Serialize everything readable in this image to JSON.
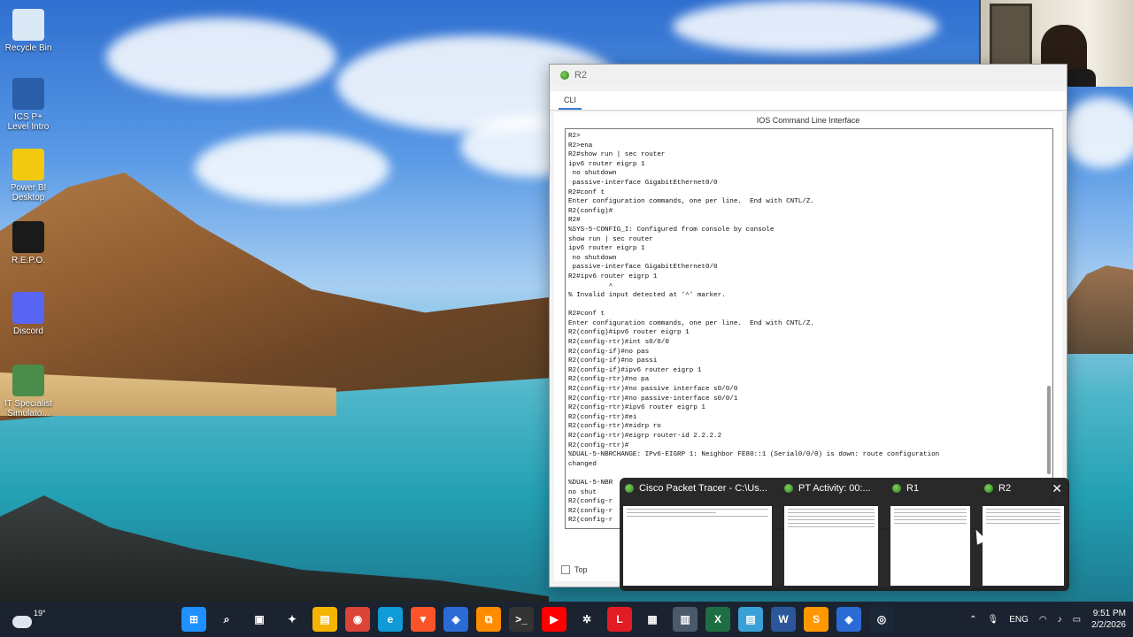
{
  "desktop_icons": [
    {
      "label": "Recycle Bin",
      "icon": "recycle-bin-icon",
      "color": "#dbe8f5"
    },
    {
      "label": "ICS P+ Level Intro",
      "icon": "plus-icon",
      "color": "#2a5ea8"
    },
    {
      "label": "Power BI Desktop",
      "icon": "power-bi-icon",
      "color": "#f2c811"
    },
    {
      "label": "R.E.P.O.",
      "icon": "repo-icon",
      "color": "#1a1a1a"
    },
    {
      "label": "Discord",
      "icon": "discord-icon",
      "color": "#5865f2"
    },
    {
      "label": "IT Specialist Simulato...",
      "icon": "network-icon",
      "color": "#4a8c4a"
    }
  ],
  "window": {
    "title": "R2",
    "tab": "CLI",
    "panel_title": "IOS Command Line Interface",
    "top_checkbox_label": "Top",
    "cli_lines": [
      "R2>",
      "R2>ena",
      "R2#show run | sec router",
      "ipv6 router eigrp 1",
      " no shutdown",
      " passive-interface GigabitEthernet0/0",
      "R2#conf t",
      "Enter configuration commands, one per line.  End with CNTL/Z.",
      "R2(config)#",
      "R2#",
      "%SYS-5-CONFIG_I: Configured from console by console",
      "show run | sec router",
      "ipv6 router eigrp 1",
      " no shutdown",
      " passive-interface GigabitEthernet0/0",
      "R2#ipv6 router eigrp 1",
      "          ^",
      "% Invalid input detected at '^' marker.",
      "",
      "R2#conf t",
      "Enter configuration commands, one per line.  End with CNTL/Z.",
      "R2(config)#ipv6 router eigrp 1",
      "R2(config-rtr)#int s0/0/0",
      "R2(config-if)#no pas",
      "R2(config-if)#no passi",
      "R2(config-if)#ipv6 router eigrp 1",
      "R2(config-rtr)#no pa",
      "R2(config-rtr)#no passive interface s0/0/0",
      "R2(config-rtr)#no passive-interface s0/0/1",
      "R2(config-rtr)#ipv6 router eigrp 1",
      "R2(config-rtr)#ei",
      "R2(config-rtr)#eidrp ro",
      "R2(config-rtr)#eigrp router-id 2.2.2.2",
      "R2(config-rtr)#",
      "%DUAL-5-NBRCHANGE: IPv6-EIGRP 1: Neighbor FE80::1 (Serial0/0/0) is down: route configuration",
      "changed",
      "",
      "%DUAL-5-NBR",
      "no shut",
      "R2(config-r",
      "R2(config-r",
      "R2(config-r"
    ]
  },
  "thumbnails": [
    {
      "title": "Cisco Packet Tracer - C:\\Us...",
      "icon": "packet-tracer-icon"
    },
    {
      "title": "PT Activity: 00:...",
      "icon": "packet-tracer-icon"
    },
    {
      "title": "R1",
      "icon": "packet-tracer-icon"
    },
    {
      "title": "R2",
      "icon": "packet-tracer-icon",
      "close": "✕"
    }
  ],
  "taskbar": {
    "weather_temp": "19°",
    "apps": [
      {
        "name": "windows-start-icon",
        "glyph": "⊞",
        "color": "#1e90ff"
      },
      {
        "name": "search-icon",
        "glyph": "⌕",
        "color": "transparent"
      },
      {
        "name": "task-view-icon",
        "glyph": "▣",
        "color": "transparent"
      },
      {
        "name": "copilot-icon",
        "glyph": "✦",
        "color": "transparent"
      },
      {
        "name": "file-explorer-icon",
        "glyph": "▤",
        "color": "#f4b400"
      },
      {
        "name": "chrome-icon",
        "glyph": "◉",
        "color": "#db4437"
      },
      {
        "name": "edge-icon",
        "glyph": "e",
        "color": "#0f9ad8"
      },
      {
        "name": "brave-icon",
        "glyph": "▼",
        "color": "#fb542b"
      },
      {
        "name": "packet-tracer-icon",
        "glyph": "◈",
        "color": "#2a6bd6"
      },
      {
        "name": "app-orange-icon",
        "glyph": "⧉",
        "color": "#ff8c00"
      },
      {
        "name": "terminal-icon",
        "glyph": ">_",
        "color": "#333"
      },
      {
        "name": "youtube-icon",
        "glyph": "▶",
        "color": "#ff0000"
      },
      {
        "name": "chatgpt-icon",
        "glyph": "✲",
        "color": "transparent"
      },
      {
        "name": "lumion-icon",
        "glyph": "L",
        "color": "#e31b23"
      },
      {
        "name": "store-icon",
        "glyph": "▦",
        "color": "transparent"
      },
      {
        "name": "calculator-icon",
        "glyph": "▥",
        "color": "#4a5a6a"
      },
      {
        "name": "excel-icon",
        "glyph": "X",
        "color": "#1d6f42"
      },
      {
        "name": "notepad-icon",
        "glyph": "▤",
        "color": "#3aa0d8"
      },
      {
        "name": "word-icon",
        "glyph": "W",
        "color": "#2b579a"
      },
      {
        "name": "sublime-icon",
        "glyph": "S",
        "color": "#ff9800"
      },
      {
        "name": "packet-tracer-running-icon",
        "glyph": "◈",
        "color": "#2a6bd6"
      },
      {
        "name": "steam-icon",
        "glyph": "◎",
        "color": "#1b2838"
      }
    ],
    "lang": "ENG",
    "time": "9:51 PM",
    "date": "2/2/2026"
  }
}
